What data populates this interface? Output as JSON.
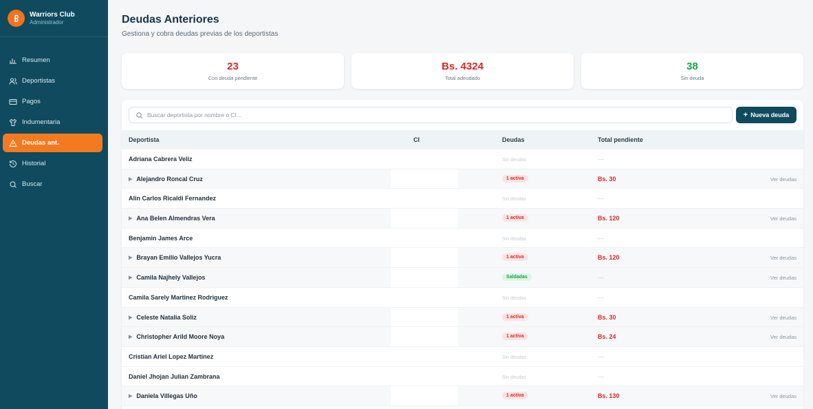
{
  "sidebar": {
    "brand_name": "Warriors Club",
    "brand_role": "Administrador",
    "items": [
      {
        "label": "Resumen",
        "icon": "bar-chart-icon"
      },
      {
        "label": "Deportistas",
        "icon": "users-icon"
      },
      {
        "label": "Pagos",
        "icon": "credit-card-icon"
      },
      {
        "label": "Indumentaria",
        "icon": "shirt-icon"
      },
      {
        "label": "Deudas ant.",
        "icon": "warning-icon",
        "active": true
      },
      {
        "label": "Historial",
        "icon": "history-icon"
      },
      {
        "label": "Buscar",
        "icon": "search-icon"
      }
    ]
  },
  "page": {
    "title": "Deudas Anteriores",
    "subtitle": "Gestiona y cobra deudas previas de los deportistas"
  },
  "stats": [
    {
      "value": "23",
      "label": "Con deuda pendiente",
      "tone": "red"
    },
    {
      "value": "Bs. 4324",
      "label": "Total adeudado",
      "tone": "red"
    },
    {
      "value": "38",
      "label": "Sin deuda",
      "tone": "green"
    }
  ],
  "search": {
    "placeholder": "Buscar deportista por nombre o CI..."
  },
  "new_button": {
    "label": "Nueva deuda"
  },
  "table": {
    "headers": {
      "athlete": "Deportista",
      "ci": "CI",
      "debts": "Deudas",
      "total": "Total pendiente"
    },
    "rows": [
      {
        "name": "Adriana Cabrera Veliz",
        "expand": false,
        "debts": "Sin deudas",
        "debts_kind": "none",
        "total": "—",
        "link": ""
      },
      {
        "name": "Alejandro Roncal Cruz",
        "expand": true,
        "debts": "1 activa",
        "debts_kind": "active",
        "total": "Bs. 30",
        "link": "Ver deudas"
      },
      {
        "name": "Alin Carlos Ricaldi Fernandez",
        "expand": false,
        "debts": "Sin deudas",
        "debts_kind": "none",
        "total": "—",
        "link": ""
      },
      {
        "name": "Ana Belen Almendras Vera",
        "expand": true,
        "debts": "1 activa",
        "debts_kind": "active",
        "total": "Bs. 120",
        "link": "Ver deudas"
      },
      {
        "name": "Benjamin James Arce",
        "expand": false,
        "debts": "Sin deudas",
        "debts_kind": "none",
        "total": "—",
        "link": ""
      },
      {
        "name": "Brayan Emilio Vallejos Yucra",
        "expand": true,
        "debts": "1 activa",
        "debts_kind": "active",
        "total": "Bs. 120",
        "link": "Ver deudas"
      },
      {
        "name": "Camila Najhely Vallejos",
        "expand": true,
        "debts": "Saldadas",
        "debts_kind": "paid",
        "total": "—",
        "link": "Ver deudas"
      },
      {
        "name": "Camila Sarely Martinez Rodriguez",
        "expand": false,
        "debts": "Sin deudas",
        "debts_kind": "none",
        "total": "—",
        "link": ""
      },
      {
        "name": "Celeste Natalia Soliz",
        "expand": true,
        "debts": "1 activa",
        "debts_kind": "active",
        "total": "Bs. 30",
        "link": "Ver deudas"
      },
      {
        "name": "Christopher Arild Moore Noya",
        "expand": true,
        "debts": "1 activa",
        "debts_kind": "active",
        "total": "Bs. 24",
        "link": "Ver deudas"
      },
      {
        "name": "Cristian Ariel Lopez Martinez",
        "expand": false,
        "debts": "Sin deudas",
        "debts_kind": "none",
        "total": "—",
        "link": ""
      },
      {
        "name": "Daniel Jhojan Julian Zambrana",
        "expand": false,
        "debts": "Sin deudas",
        "debts_kind": "none",
        "total": "—",
        "link": ""
      },
      {
        "name": "Daniela Villegas Uño",
        "expand": true,
        "debts": "1 activa",
        "debts_kind": "active",
        "total": "Bs. 130",
        "link": "Ver deudas"
      }
    ]
  },
  "colors": {
    "sidebar": "#0f4a5e",
    "accent": "#f47a20",
    "danger": "#dc2626",
    "success": "#16a34a"
  }
}
